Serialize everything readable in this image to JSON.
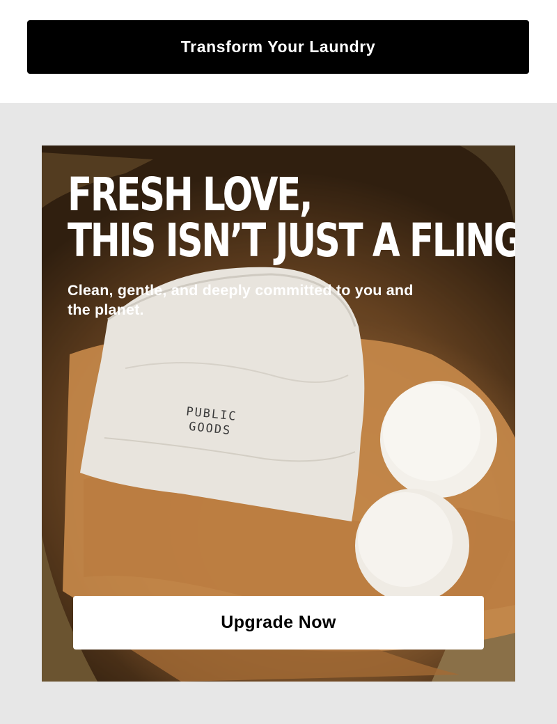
{
  "header": {
    "cta_label": "Transform Your Laundry"
  },
  "hero": {
    "headline_line1": "FRESH LOVE,",
    "headline_line2": "THIS ISN’T JUST A FLING",
    "subhead": "Clean, gentle, and deeply committed to you and the planet.",
    "bag_brand_line1": "PUBLIC",
    "bag_brand_line2": "GOODS",
    "cta_label": "Upgrade Now"
  },
  "colors": {
    "page_background": "#ffffff",
    "panel_background": "#e7e7e7",
    "top_button_background": "#000000",
    "hero_button_background": "#ffffff"
  }
}
